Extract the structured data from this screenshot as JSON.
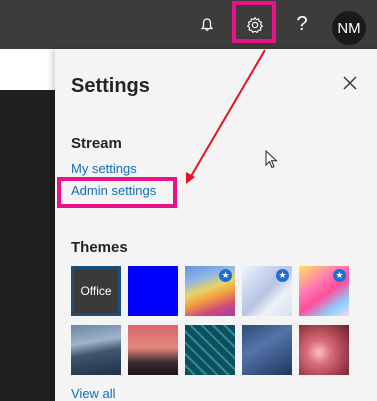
{
  "topbar": {
    "help_label": "?",
    "avatar_initials": "NM"
  },
  "settings": {
    "title": "Settings",
    "stream": {
      "heading": "Stream",
      "my_settings": "My settings",
      "admin_settings": "Admin settings"
    },
    "themes": {
      "heading": "Themes",
      "items": [
        {
          "name": "Office",
          "label": "Office",
          "selected": true
        },
        {
          "name": "Blue"
        },
        {
          "name": "Rainbow",
          "badge": "star"
        },
        {
          "name": "Unicorn",
          "badge": "star"
        },
        {
          "name": "Pink unicorn",
          "badge": "star"
        },
        {
          "name": "Mountain"
        },
        {
          "name": "Palm trees"
        },
        {
          "name": "Circuit board"
        },
        {
          "name": "Aviation"
        },
        {
          "name": "Pink lights"
        }
      ],
      "view_all": "View all"
    }
  },
  "colors": {
    "topbar": "#3c3c3c",
    "panel": "#f4f4f4",
    "link": "#106ebe",
    "highlight": "#e8118a",
    "arrow": "#e81123"
  }
}
